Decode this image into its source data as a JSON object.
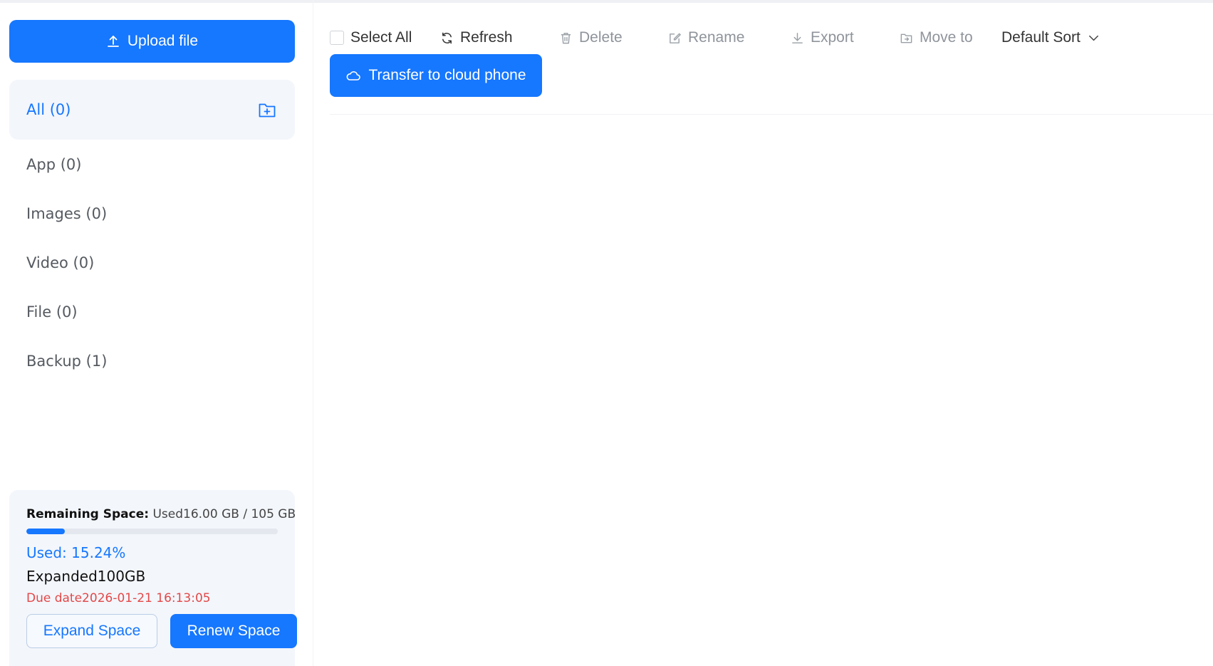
{
  "sidebar": {
    "upload_label": "Upload file",
    "categories": [
      {
        "label": "All (0)",
        "active": true
      },
      {
        "label": "App (0)"
      },
      {
        "label": "Images (0)"
      },
      {
        "label": "Video (0)"
      },
      {
        "label": "File (0)"
      },
      {
        "label": "Backup (1)"
      }
    ],
    "storage": {
      "title": "Remaining Space:",
      "used_text": "Used16.00 GB / 105 GB",
      "used_fraction": 0.1524,
      "used_percent_label": "Used: 15.24%",
      "expanded_label": "Expanded100GB",
      "due_label": "Due date2026-01-21 16:13:05",
      "expand_button": "Expand Space",
      "renew_button": "Renew Space"
    }
  },
  "toolbar": {
    "select_all": "Select All",
    "refresh": "Refresh",
    "delete": "Delete",
    "rename": "Rename",
    "export": "Export",
    "move_to": "Move to",
    "sort": "Default Sort",
    "transfer": "Transfer to cloud phone"
  },
  "colors": {
    "accent": "#1677ff",
    "due": "#e34848",
    "panel_bg": "#f3f6fb"
  }
}
